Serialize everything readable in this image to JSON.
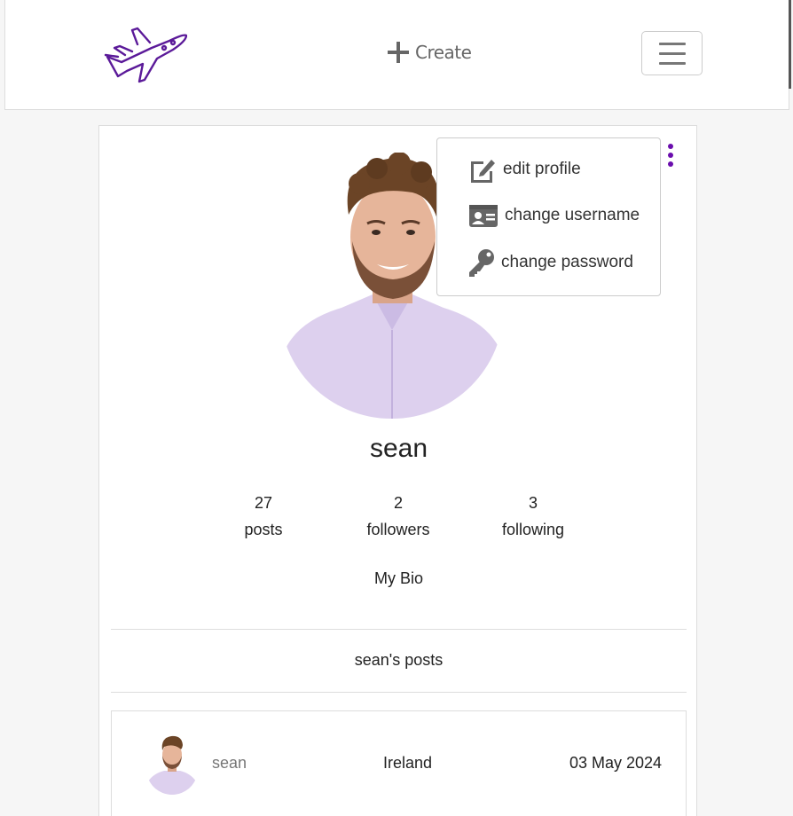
{
  "navbar": {
    "logo_icon": "airplane-icon",
    "create_label": "Create",
    "create_icon": "plus-icon",
    "menu_icon": "hamburger-icon"
  },
  "profile": {
    "username": "sean",
    "stats": [
      {
        "value": "27",
        "label": "posts"
      },
      {
        "value": "2",
        "label": "followers"
      },
      {
        "value": "3",
        "label": "following"
      }
    ],
    "bio": "My Bio",
    "posts_heading": "sean's posts"
  },
  "menu": {
    "trigger_icon": "kebab-icon",
    "items": [
      {
        "label": "edit profile",
        "icon": "edit-icon"
      },
      {
        "label": "change username",
        "icon": "id-card-icon"
      },
      {
        "label": "change password",
        "icon": "key-icon"
      }
    ]
  },
  "posts": [
    {
      "owner": "sean",
      "location": "Ireland",
      "date": "03 May 2024"
    }
  ],
  "colors": {
    "accent": "#6a0dad",
    "logo": "#5b1a99",
    "icon_gray": "#666666",
    "border": "#dddddd",
    "background": "#f6f6f6"
  }
}
